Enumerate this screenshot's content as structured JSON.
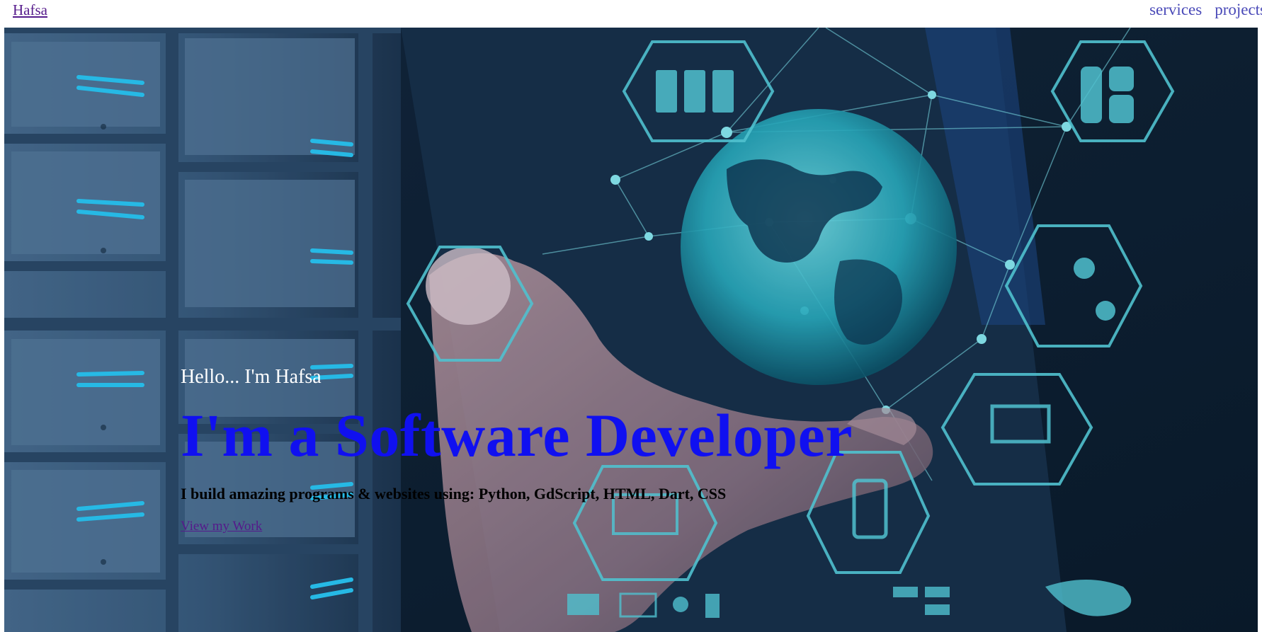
{
  "nav": {
    "brand": "Hafsa",
    "links": [
      "services",
      "projects"
    ]
  },
  "hero": {
    "greeting": "Hello... I'm Hafsa",
    "headline": "I'm a Software Developer",
    "subline": "I build amazing programs & websites using: Python, GdScript, HTML, Dart, CSS",
    "cta": "View my Work",
    "background_image": "server-racks-hand-holographic-globe"
  },
  "colors": {
    "headline": "#1010f0",
    "link_visited": "#551a8b",
    "nav_link": "#4a4ab8",
    "hero_base": "#0e2a44",
    "hologram": "#4fe0ef"
  }
}
